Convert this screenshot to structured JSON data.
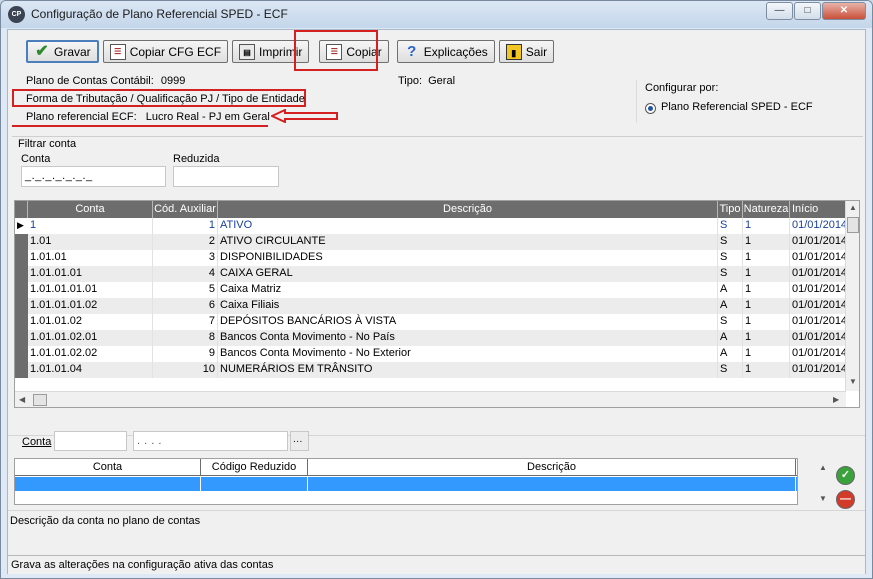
{
  "window": {
    "title": "Configuração de Plano Referencial SPED - ECF",
    "icon_text": "CP"
  },
  "toolbar": {
    "gravar": "Gravar",
    "copiar_cfg": "Copiar CFG ECF",
    "imprimir": "Imprimir",
    "copiar": "Copiar",
    "explicacoes": "Explicações",
    "sair": "Sair"
  },
  "info": {
    "plano_label": "Plano de Contas Contábil:",
    "plano_value": "0999",
    "tipo_label": "Tipo:",
    "tipo_value": "Geral",
    "forma_label": "Forma de Tributação / Qualificação PJ / Tipo de Entidade",
    "referencial_label": "Plano referencial ECF:",
    "referencial_value": "Lucro Real - PJ em Geral"
  },
  "configurar": {
    "label": "Configurar por:",
    "option": "Plano Referencial SPED - ECF"
  },
  "filtro": {
    "title": "Filtrar conta",
    "conta_label": "Conta",
    "conta_value": "_._._._._._._",
    "reduzida_label": "Reduzida"
  },
  "grid": {
    "columns": [
      "Conta",
      "Cód. Auxiliar",
      "Descrição",
      "Tipo",
      "Natureza",
      "Início"
    ],
    "rows": [
      [
        "1",
        "1",
        "ATIVO",
        "S",
        "1",
        "01/01/2014"
      ],
      [
        "1.01",
        "2",
        "ATIVO CIRCULANTE",
        "S",
        "1",
        "01/01/2014"
      ],
      [
        "1.01.01",
        "3",
        "DISPONIBILIDADES",
        "S",
        "1",
        "01/01/2014"
      ],
      [
        "1.01.01.01",
        "4",
        "CAIXA GERAL",
        "S",
        "1",
        "01/01/2014"
      ],
      [
        "1.01.01.01.01",
        "5",
        "Caixa Matriz",
        "A",
        "1",
        "01/01/2014"
      ],
      [
        "1.01.01.01.02",
        "6",
        "Caixa Filiais",
        "A",
        "1",
        "01/01/2014"
      ],
      [
        "1.01.01.02",
        "7",
        "DEPÓSITOS BANCÁRIOS À VISTA",
        "S",
        "1",
        "01/01/2014"
      ],
      [
        "1.01.01.02.01",
        "8",
        "Bancos Conta Movimento - No País",
        "A",
        "1",
        "01/01/2014"
      ],
      [
        "1.01.01.02.02",
        "9",
        "Bancos Conta Movimento - No Exterior",
        "A",
        "1",
        "01/01/2014"
      ],
      [
        "1.01.01.04",
        "10",
        "NUMERÁRIOS EM TRÂNSITO",
        "S",
        "1",
        "01/01/2014"
      ]
    ]
  },
  "lower": {
    "conta_label": "Conta",
    "conta_mask": ". . . .",
    "browse": "...",
    "columns": [
      "Conta",
      "Código Reduzido",
      "Descrição"
    ]
  },
  "status": {
    "hint": "Descrição da conta no plano de contas",
    "footer": "Grava as alterações na configuração ativa das contas"
  },
  "colors": {
    "highlight_red": "#d42020",
    "selection_blue": "#3399ff",
    "header_gray": "#6d6d6d",
    "current_row_text": "#1a3fa0"
  }
}
